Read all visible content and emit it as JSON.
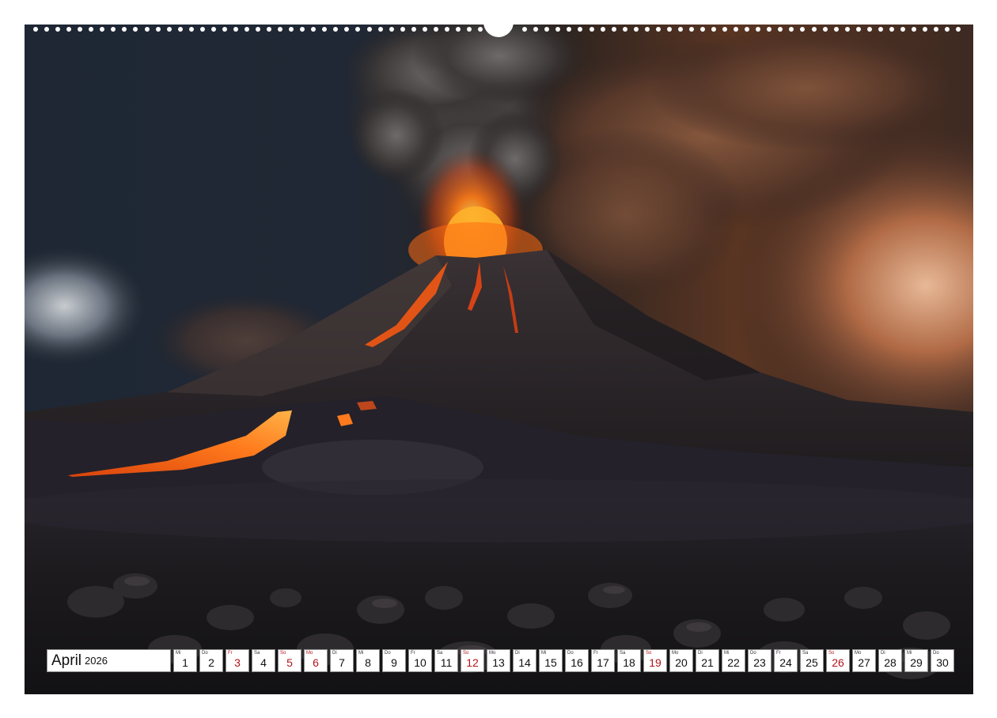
{
  "calendar": {
    "month": "April",
    "year": "2026",
    "days": [
      {
        "wd": "Mi",
        "n": "1",
        "weekend": false
      },
      {
        "wd": "Do",
        "n": "2",
        "weekend": false
      },
      {
        "wd": "Fr",
        "n": "3",
        "weekend": true
      },
      {
        "wd": "Sa",
        "n": "4",
        "weekend": false
      },
      {
        "wd": "So",
        "n": "5",
        "weekend": true
      },
      {
        "wd": "Mo",
        "n": "6",
        "weekend": true
      },
      {
        "wd": "Di",
        "n": "7",
        "weekend": false
      },
      {
        "wd": "Mi",
        "n": "8",
        "weekend": false
      },
      {
        "wd": "Do",
        "n": "9",
        "weekend": false
      },
      {
        "wd": "Fr",
        "n": "10",
        "weekend": false
      },
      {
        "wd": "Sa",
        "n": "11",
        "weekend": false
      },
      {
        "wd": "So",
        "n": "12",
        "weekend": true
      },
      {
        "wd": "Mo",
        "n": "13",
        "weekend": false
      },
      {
        "wd": "Di",
        "n": "14",
        "weekend": false
      },
      {
        "wd": "Mi",
        "n": "15",
        "weekend": false
      },
      {
        "wd": "Do",
        "n": "16",
        "weekend": false
      },
      {
        "wd": "Fr",
        "n": "17",
        "weekend": false
      },
      {
        "wd": "Sa",
        "n": "18",
        "weekend": false
      },
      {
        "wd": "So",
        "n": "19",
        "weekend": true
      },
      {
        "wd": "Mo",
        "n": "20",
        "weekend": false
      },
      {
        "wd": "Di",
        "n": "21",
        "weekend": false
      },
      {
        "wd": "Mi",
        "n": "22",
        "weekend": false
      },
      {
        "wd": "Do",
        "n": "23",
        "weekend": false
      },
      {
        "wd": "Fr",
        "n": "24",
        "weekend": false
      },
      {
        "wd": "Sa",
        "n": "25",
        "weekend": false
      },
      {
        "wd": "So",
        "n": "26",
        "weekend": true
      },
      {
        "wd": "Mo",
        "n": "27",
        "weekend": false
      },
      {
        "wd": "Di",
        "n": "28",
        "weekend": false
      },
      {
        "wd": "Mi",
        "n": "29",
        "weekend": false
      },
      {
        "wd": "Do",
        "n": "30",
        "weekend": false
      }
    ]
  },
  "colors": {
    "weekend_red": "#b3141b",
    "lava": "#ff6a10"
  }
}
